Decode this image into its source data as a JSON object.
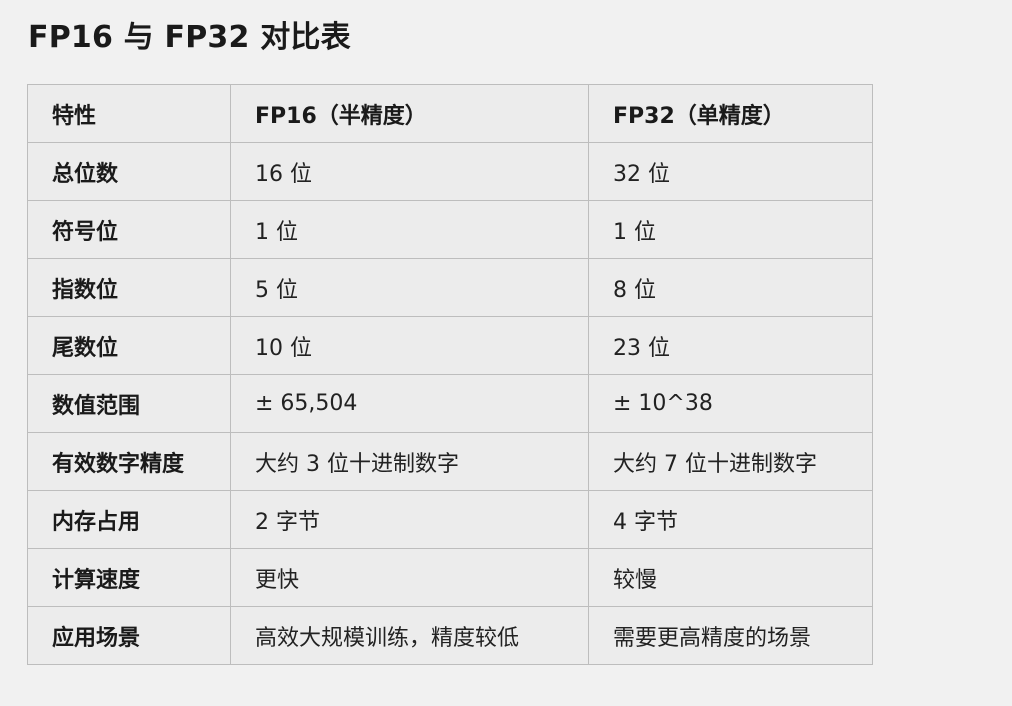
{
  "title": "FP16 与 FP32 对比表",
  "table": {
    "headers": [
      "特性",
      "FP16（半精度）",
      "FP32（单精度）"
    ],
    "rows": [
      [
        "总位数",
        "16 位",
        "32 位"
      ],
      [
        "符号位",
        "1 位",
        "1 位"
      ],
      [
        "指数位",
        "5 位",
        "8 位"
      ],
      [
        "尾数位",
        "10 位",
        "23 位"
      ],
      [
        "数值范围",
        "± 65,504",
        "± 10^38"
      ],
      [
        "有效数字精度",
        "大约 3 位十进制数字",
        "大约 7 位十进制数字"
      ],
      [
        "内存占用",
        "2 字节",
        "4 字节"
      ],
      [
        "计算速度",
        "更快",
        "较慢"
      ],
      [
        "应用场景",
        "高效大规模训练，精度较低",
        "需要更高精度的场景"
      ]
    ]
  }
}
